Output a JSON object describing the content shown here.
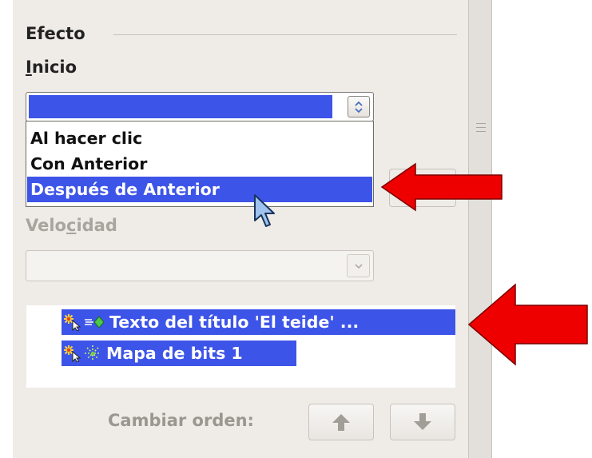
{
  "panel": {
    "section_title": "Efecto",
    "inicio": {
      "mnemonic": "I",
      "rest": "nicio"
    },
    "inicio_dropdown": {
      "selected_value": "",
      "options": [
        "Al hacer clic",
        "Con Anterior",
        "Después de Anterior"
      ],
      "highlighted_index": 2
    },
    "velocidad": {
      "before": "Velo",
      "mnemonic": "c",
      "after": "idad"
    },
    "velocidad_value": "",
    "effects_list": [
      {
        "label": "Texto del título 'El teide' ...",
        "start_icon": "mouse-click-start-icon",
        "effect_icon": "fly-in-effect-icon"
      },
      {
        "label": "Mapa de bits 1",
        "start_icon": "mouse-click-start-icon",
        "effect_icon": "sparkle-effect-icon"
      }
    ],
    "change_order_label": "Cambiar orden:",
    "move_up_icon": "arrow-up-icon",
    "move_down_icon": "arrow-down-icon"
  },
  "colors": {
    "selection": "#3d54e8",
    "annotation_arrow": "#ee0000",
    "panel_bg": "#efebe7"
  }
}
